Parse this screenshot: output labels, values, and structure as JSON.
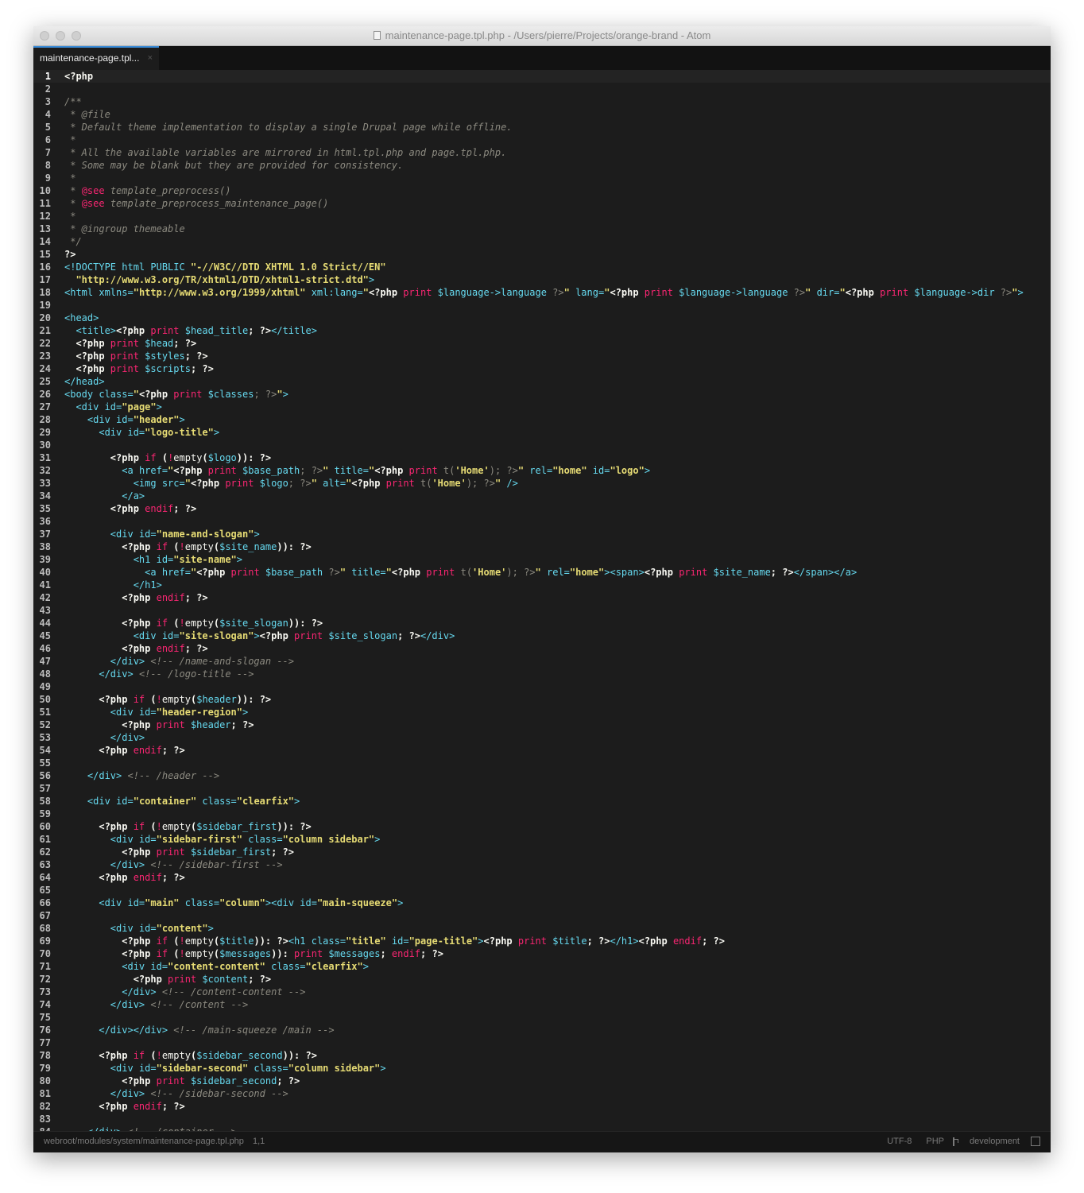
{
  "window": {
    "title": "maintenance-page.tpl.php - /Users/pierre/Projects/orange-brand - Atom"
  },
  "tab": {
    "label": "maintenance-page.tpl...",
    "close": "×"
  },
  "status": {
    "path": "webroot/modules/system/maintenance-page.tpl.php",
    "cursor": "1,1",
    "encoding": "UTF-8",
    "grammar": "PHP",
    "branch": "development"
  },
  "current_line": 1,
  "lines": [
    [
      [
        "<?php",
        ""
      ]
    ],
    [],
    [
      [
        "/**",
        "c"
      ]
    ],
    [
      [
        " * @file",
        "c"
      ]
    ],
    [
      [
        " * Default theme implementation to display a single Drupal page while offline.",
        "c"
      ]
    ],
    [
      [
        " *",
        "c"
      ]
    ],
    [
      [
        " * All the available variables are mirrored in html.tpl.php and page.tpl.php.",
        "c"
      ]
    ],
    [
      [
        " * Some may be blank but they are provided for consistency.",
        "c"
      ]
    ],
    [
      [
        " *",
        "c"
      ]
    ],
    [
      [
        " * ",
        "c"
      ],
      [
        "@see",
        "k"
      ],
      [
        " template_preprocess()",
        "c"
      ]
    ],
    [
      [
        " * ",
        "c"
      ],
      [
        "@see",
        "k"
      ],
      [
        " template_preprocess_maintenance_page()",
        "c"
      ]
    ],
    [
      [
        " *",
        "c"
      ]
    ],
    [
      [
        " * @ingroup themeable",
        "c"
      ]
    ],
    [
      [
        " */",
        "c"
      ]
    ],
    [
      [
        "?>",
        ""
      ]
    ],
    [
      [
        "<!DOCTYPE html PUBLIC ",
        "tag"
      ],
      [
        "\"-//W3C//DTD XHTML 1.0 Strict//EN\"",
        "str"
      ]
    ],
    [
      [
        "  ",
        ""
      ],
      [
        "\"http://www.w3.org/TR/xhtml1/DTD/xhtml1-strict.dtd\"",
        "str"
      ],
      [
        ">",
        "tag"
      ]
    ],
    [
      [
        "<html ",
        "tag"
      ],
      [
        "xmlns=",
        "attr"
      ],
      [
        "\"http://www.w3.org/1999/xhtml\"",
        "str"
      ],
      [
        " xml:lang=",
        "attr"
      ],
      [
        "\"",
        "str"
      ],
      [
        "<?php",
        ""
      ],
      [
        " print ",
        "k"
      ],
      [
        "$language->language",
        "v"
      ],
      [
        " ?>",
        "p"
      ],
      [
        "\"",
        "str"
      ],
      [
        " lang=",
        "attr"
      ],
      [
        "\"",
        "str"
      ],
      [
        "<?php",
        ""
      ],
      [
        " print ",
        "k"
      ],
      [
        "$language->language",
        "v"
      ],
      [
        " ?>",
        "p"
      ],
      [
        "\"",
        "str"
      ],
      [
        " dir=",
        "attr"
      ],
      [
        "\"",
        "str"
      ],
      [
        "<?php",
        ""
      ],
      [
        " print ",
        "k"
      ],
      [
        "$language->dir",
        "v"
      ],
      [
        " ?>",
        "p"
      ],
      [
        "\"",
        "str"
      ],
      [
        ">",
        "tag"
      ]
    ],
    [],
    [
      [
        "<head>",
        "tag"
      ]
    ],
    [
      [
        "  ",
        ""
      ],
      [
        "<title>",
        "tag"
      ],
      [
        "<?php",
        ""
      ],
      [
        " print ",
        "k"
      ],
      [
        "$head_title",
        "v"
      ],
      [
        "; ",
        ""
      ],
      [
        "?>",
        ""
      ],
      [
        "</title>",
        "tag"
      ]
    ],
    [
      [
        "  <?php",
        ""
      ],
      [
        " print ",
        "k"
      ],
      [
        "$head",
        "v"
      ],
      [
        "; ?>",
        ""
      ]
    ],
    [
      [
        "  <?php",
        ""
      ],
      [
        " print ",
        "k"
      ],
      [
        "$styles",
        "v"
      ],
      [
        "; ?>",
        ""
      ]
    ],
    [
      [
        "  <?php",
        ""
      ],
      [
        " print ",
        "k"
      ],
      [
        "$scripts",
        "v"
      ],
      [
        "; ?>",
        ""
      ]
    ],
    [
      [
        "</head>",
        "tag"
      ]
    ],
    [
      [
        "<body ",
        "tag"
      ],
      [
        "class=",
        "attr"
      ],
      [
        "\"",
        "str"
      ],
      [
        "<?php",
        ""
      ],
      [
        " print ",
        "k"
      ],
      [
        "$classes",
        "v"
      ],
      [
        "; ?>",
        "p"
      ],
      [
        "\"",
        "str"
      ],
      [
        ">",
        "tag"
      ]
    ],
    [
      [
        "  ",
        ""
      ],
      [
        "<div ",
        "tag"
      ],
      [
        "id=",
        "attr"
      ],
      [
        "\"page\"",
        "str"
      ],
      [
        ">",
        "tag"
      ]
    ],
    [
      [
        "    ",
        ""
      ],
      [
        "<div ",
        "tag"
      ],
      [
        "id=",
        "attr"
      ],
      [
        "\"header\"",
        "str"
      ],
      [
        ">",
        "tag"
      ]
    ],
    [
      [
        "      ",
        ""
      ],
      [
        "<div ",
        "tag"
      ],
      [
        "id=",
        "attr"
      ],
      [
        "\"logo-title\"",
        "str"
      ],
      [
        ">",
        "tag"
      ]
    ],
    [],
    [
      [
        "        <?php",
        ""
      ],
      [
        " if ",
        "k"
      ],
      [
        "(",
        ""
      ],
      [
        "!",
        "k"
      ],
      [
        "empty",
        "fn"
      ],
      [
        "(",
        ""
      ],
      [
        "$logo",
        "v"
      ],
      [
        ")): ?>",
        ""
      ]
    ],
    [
      [
        "          ",
        ""
      ],
      [
        "<a ",
        "tag"
      ],
      [
        "href=",
        "attr"
      ],
      [
        "\"",
        "str"
      ],
      [
        "<?php",
        ""
      ],
      [
        " print ",
        "k"
      ],
      [
        "$base_path",
        "v"
      ],
      [
        "; ?>",
        "p"
      ],
      [
        "\"",
        "str"
      ],
      [
        " title=",
        "attr"
      ],
      [
        "\"",
        "str"
      ],
      [
        "<?php",
        ""
      ],
      [
        " print ",
        "k"
      ],
      [
        "t(",
        "p"
      ],
      [
        "'Home'",
        "str"
      ],
      [
        "); ?>",
        "p"
      ],
      [
        "\"",
        "str"
      ],
      [
        " rel=",
        "attr"
      ],
      [
        "\"home\"",
        "str"
      ],
      [
        " id=",
        "attr"
      ],
      [
        "\"logo\"",
        "str"
      ],
      [
        ">",
        "tag"
      ]
    ],
    [
      [
        "            ",
        ""
      ],
      [
        "<img ",
        "tag"
      ],
      [
        "src=",
        "attr"
      ],
      [
        "\"",
        "str"
      ],
      [
        "<?php",
        ""
      ],
      [
        " print ",
        "k"
      ],
      [
        "$logo",
        "v"
      ],
      [
        "; ?>",
        "p"
      ],
      [
        "\"",
        "str"
      ],
      [
        " alt=",
        "attr"
      ],
      [
        "\"",
        "str"
      ],
      [
        "<?php",
        ""
      ],
      [
        " print ",
        "k"
      ],
      [
        "t(",
        "p"
      ],
      [
        "'Home'",
        "str"
      ],
      [
        "); ?>",
        "p"
      ],
      [
        "\"",
        "str"
      ],
      [
        " />",
        "tag"
      ]
    ],
    [
      [
        "          ",
        ""
      ],
      [
        "</a>",
        "tag"
      ]
    ],
    [
      [
        "        <?php",
        ""
      ],
      [
        " endif",
        "k"
      ],
      [
        "; ?>",
        ""
      ]
    ],
    [],
    [
      [
        "        ",
        ""
      ],
      [
        "<div ",
        "tag"
      ],
      [
        "id=",
        "attr"
      ],
      [
        "\"name-and-slogan\"",
        "str"
      ],
      [
        ">",
        "tag"
      ]
    ],
    [
      [
        "          <?php",
        ""
      ],
      [
        " if ",
        "k"
      ],
      [
        "(",
        ""
      ],
      [
        "!",
        "k"
      ],
      [
        "empty",
        "fn"
      ],
      [
        "(",
        ""
      ],
      [
        "$site_name",
        "v"
      ],
      [
        ")): ?>",
        ""
      ]
    ],
    [
      [
        "            ",
        ""
      ],
      [
        "<h1 ",
        "tag"
      ],
      [
        "id=",
        "attr"
      ],
      [
        "\"site-name\"",
        "str"
      ],
      [
        ">",
        "tag"
      ]
    ],
    [
      [
        "              ",
        ""
      ],
      [
        "<a ",
        "tag"
      ],
      [
        "href=",
        "attr"
      ],
      [
        "\"",
        "str"
      ],
      [
        "<?php",
        ""
      ],
      [
        " print ",
        "k"
      ],
      [
        "$base_path",
        "v"
      ],
      [
        " ?>",
        "p"
      ],
      [
        "\"",
        "str"
      ],
      [
        " title=",
        "attr"
      ],
      [
        "\"",
        "str"
      ],
      [
        "<?php",
        ""
      ],
      [
        " print ",
        "k"
      ],
      [
        "t(",
        "p"
      ],
      [
        "'Home'",
        "str"
      ],
      [
        "); ?>",
        "p"
      ],
      [
        "\"",
        "str"
      ],
      [
        " rel=",
        "attr"
      ],
      [
        "\"home\"",
        "str"
      ],
      [
        ">",
        "tag"
      ],
      [
        "<span>",
        "tag"
      ],
      [
        "<?php",
        ""
      ],
      [
        " print ",
        "k"
      ],
      [
        "$site_name",
        "v"
      ],
      [
        "; ?>",
        ""
      ],
      [
        "</span></a>",
        "tag"
      ]
    ],
    [
      [
        "            ",
        ""
      ],
      [
        "</h1>",
        "tag"
      ]
    ],
    [
      [
        "          <?php",
        ""
      ],
      [
        " endif",
        "k"
      ],
      [
        "; ?>",
        ""
      ]
    ],
    [],
    [
      [
        "          <?php",
        ""
      ],
      [
        " if ",
        "k"
      ],
      [
        "(",
        ""
      ],
      [
        "!",
        "k"
      ],
      [
        "empty",
        "fn"
      ],
      [
        "(",
        ""
      ],
      [
        "$site_slogan",
        "v"
      ],
      [
        ")): ?>",
        ""
      ]
    ],
    [
      [
        "            ",
        ""
      ],
      [
        "<div ",
        "tag"
      ],
      [
        "id=",
        "attr"
      ],
      [
        "\"site-slogan\"",
        "str"
      ],
      [
        ">",
        "tag"
      ],
      [
        "<?php",
        ""
      ],
      [
        " print ",
        "k"
      ],
      [
        "$site_slogan",
        "v"
      ],
      [
        "; ?>",
        ""
      ],
      [
        "</div>",
        "tag"
      ]
    ],
    [
      [
        "          <?php",
        ""
      ],
      [
        " endif",
        "k"
      ],
      [
        "; ?>",
        ""
      ]
    ],
    [
      [
        "        ",
        ""
      ],
      [
        "</div>",
        "tag"
      ],
      [
        " <!-- /name-and-slogan -->",
        "c"
      ]
    ],
    [
      [
        "      ",
        ""
      ],
      [
        "</div>",
        "tag"
      ],
      [
        " <!-- /logo-title -->",
        "c"
      ]
    ],
    [],
    [
      [
        "      <?php",
        ""
      ],
      [
        " if ",
        "k"
      ],
      [
        "(",
        ""
      ],
      [
        "!",
        "k"
      ],
      [
        "empty",
        "fn"
      ],
      [
        "(",
        ""
      ],
      [
        "$header",
        "v"
      ],
      [
        ")): ?>",
        ""
      ]
    ],
    [
      [
        "        ",
        ""
      ],
      [
        "<div ",
        "tag"
      ],
      [
        "id=",
        "attr"
      ],
      [
        "\"header-region\"",
        "str"
      ],
      [
        ">",
        "tag"
      ]
    ],
    [
      [
        "          <?php",
        ""
      ],
      [
        " print ",
        "k"
      ],
      [
        "$header",
        "v"
      ],
      [
        "; ?>",
        ""
      ]
    ],
    [
      [
        "        ",
        ""
      ],
      [
        "</div>",
        "tag"
      ]
    ],
    [
      [
        "      <?php",
        ""
      ],
      [
        " endif",
        "k"
      ],
      [
        "; ?>",
        ""
      ]
    ],
    [],
    [
      [
        "    ",
        ""
      ],
      [
        "</div>",
        "tag"
      ],
      [
        " <!-- /header -->",
        "c"
      ]
    ],
    [],
    [
      [
        "    ",
        ""
      ],
      [
        "<div ",
        "tag"
      ],
      [
        "id=",
        "attr"
      ],
      [
        "\"container\"",
        "str"
      ],
      [
        " class=",
        "attr"
      ],
      [
        "\"clearfix\"",
        "str"
      ],
      [
        ">",
        "tag"
      ]
    ],
    [],
    [
      [
        "      <?php",
        ""
      ],
      [
        " if ",
        "k"
      ],
      [
        "(",
        ""
      ],
      [
        "!",
        "k"
      ],
      [
        "empty",
        "fn"
      ],
      [
        "(",
        ""
      ],
      [
        "$sidebar_first",
        "v"
      ],
      [
        ")): ?>",
        ""
      ]
    ],
    [
      [
        "        ",
        ""
      ],
      [
        "<div ",
        "tag"
      ],
      [
        "id=",
        "attr"
      ],
      [
        "\"sidebar-first\"",
        "str"
      ],
      [
        " class=",
        "attr"
      ],
      [
        "\"column sidebar\"",
        "str"
      ],
      [
        ">",
        "tag"
      ]
    ],
    [
      [
        "          <?php",
        ""
      ],
      [
        " print ",
        "k"
      ],
      [
        "$sidebar_first",
        "v"
      ],
      [
        "; ?>",
        ""
      ]
    ],
    [
      [
        "        ",
        ""
      ],
      [
        "</div>",
        "tag"
      ],
      [
        " <!-- /sidebar-first -->",
        "c"
      ]
    ],
    [
      [
        "      <?php",
        ""
      ],
      [
        " endif",
        "k"
      ],
      [
        "; ?>",
        ""
      ]
    ],
    [],
    [
      [
        "      ",
        ""
      ],
      [
        "<div ",
        "tag"
      ],
      [
        "id=",
        "attr"
      ],
      [
        "\"main\"",
        "str"
      ],
      [
        " class=",
        "attr"
      ],
      [
        "\"column\"",
        "str"
      ],
      [
        ">",
        "tag"
      ],
      [
        "<div ",
        "tag"
      ],
      [
        "id=",
        "attr"
      ],
      [
        "\"main-squeeze\"",
        "str"
      ],
      [
        ">",
        "tag"
      ]
    ],
    [],
    [
      [
        "        ",
        ""
      ],
      [
        "<div ",
        "tag"
      ],
      [
        "id=",
        "attr"
      ],
      [
        "\"content\"",
        "str"
      ],
      [
        ">",
        "tag"
      ]
    ],
    [
      [
        "          <?php",
        ""
      ],
      [
        " if ",
        "k"
      ],
      [
        "(",
        ""
      ],
      [
        "!",
        "k"
      ],
      [
        "empty",
        "fn"
      ],
      [
        "(",
        ""
      ],
      [
        "$title",
        "v"
      ],
      [
        ")): ?>",
        ""
      ],
      [
        "<h1 ",
        "tag"
      ],
      [
        "class=",
        "attr"
      ],
      [
        "\"title\"",
        "str"
      ],
      [
        " id=",
        "attr"
      ],
      [
        "\"page-title\"",
        "str"
      ],
      [
        ">",
        "tag"
      ],
      [
        "<?php",
        ""
      ],
      [
        " print ",
        "k"
      ],
      [
        "$title",
        "v"
      ],
      [
        "; ?>",
        ""
      ],
      [
        "</h1>",
        "tag"
      ],
      [
        "<?php",
        ""
      ],
      [
        " endif",
        "k"
      ],
      [
        "; ?>",
        ""
      ]
    ],
    [
      [
        "          <?php",
        ""
      ],
      [
        " if ",
        "k"
      ],
      [
        "(",
        ""
      ],
      [
        "!",
        "k"
      ],
      [
        "empty",
        "fn"
      ],
      [
        "(",
        ""
      ],
      [
        "$messages",
        "v"
      ],
      [
        ")): ",
        ""
      ],
      [
        "print ",
        "k"
      ],
      [
        "$messages",
        "v"
      ],
      [
        "; ",
        ""
      ],
      [
        "endif",
        "k"
      ],
      [
        "; ?>",
        ""
      ]
    ],
    [
      [
        "          ",
        ""
      ],
      [
        "<div ",
        "tag"
      ],
      [
        "id=",
        "attr"
      ],
      [
        "\"content-content\"",
        "str"
      ],
      [
        " class=",
        "attr"
      ],
      [
        "\"clearfix\"",
        "str"
      ],
      [
        ">",
        "tag"
      ]
    ],
    [
      [
        "            <?php",
        ""
      ],
      [
        " print ",
        "k"
      ],
      [
        "$content",
        "v"
      ],
      [
        "; ?>",
        ""
      ]
    ],
    [
      [
        "          ",
        ""
      ],
      [
        "</div>",
        "tag"
      ],
      [
        " <!-- /content-content -->",
        "c"
      ]
    ],
    [
      [
        "        ",
        ""
      ],
      [
        "</div>",
        "tag"
      ],
      [
        " <!-- /content -->",
        "c"
      ]
    ],
    [],
    [
      [
        "      ",
        ""
      ],
      [
        "</div></div>",
        "tag"
      ],
      [
        " <!-- /main-squeeze /main -->",
        "c"
      ]
    ],
    [],
    [
      [
        "      <?php",
        ""
      ],
      [
        " if ",
        "k"
      ],
      [
        "(",
        ""
      ],
      [
        "!",
        "k"
      ],
      [
        "empty",
        "fn"
      ],
      [
        "(",
        ""
      ],
      [
        "$sidebar_second",
        "v"
      ],
      [
        ")): ?>",
        ""
      ]
    ],
    [
      [
        "        ",
        ""
      ],
      [
        "<div ",
        "tag"
      ],
      [
        "id=",
        "attr"
      ],
      [
        "\"sidebar-second\"",
        "str"
      ],
      [
        " class=",
        "attr"
      ],
      [
        "\"column sidebar\"",
        "str"
      ],
      [
        ">",
        "tag"
      ]
    ],
    [
      [
        "          <?php",
        ""
      ],
      [
        " print ",
        "k"
      ],
      [
        "$sidebar_second",
        "v"
      ],
      [
        "; ?>",
        ""
      ]
    ],
    [
      [
        "        ",
        ""
      ],
      [
        "</div>",
        "tag"
      ],
      [
        " <!-- /sidebar-second -->",
        "c"
      ]
    ],
    [
      [
        "      <?php",
        ""
      ],
      [
        " endif",
        "k"
      ],
      [
        "; ?>",
        ""
      ]
    ],
    [],
    [
      [
        "    ",
        ""
      ],
      [
        "</div>",
        "tag"
      ],
      [
        " <!-- /container -->",
        "c"
      ]
    ]
  ]
}
